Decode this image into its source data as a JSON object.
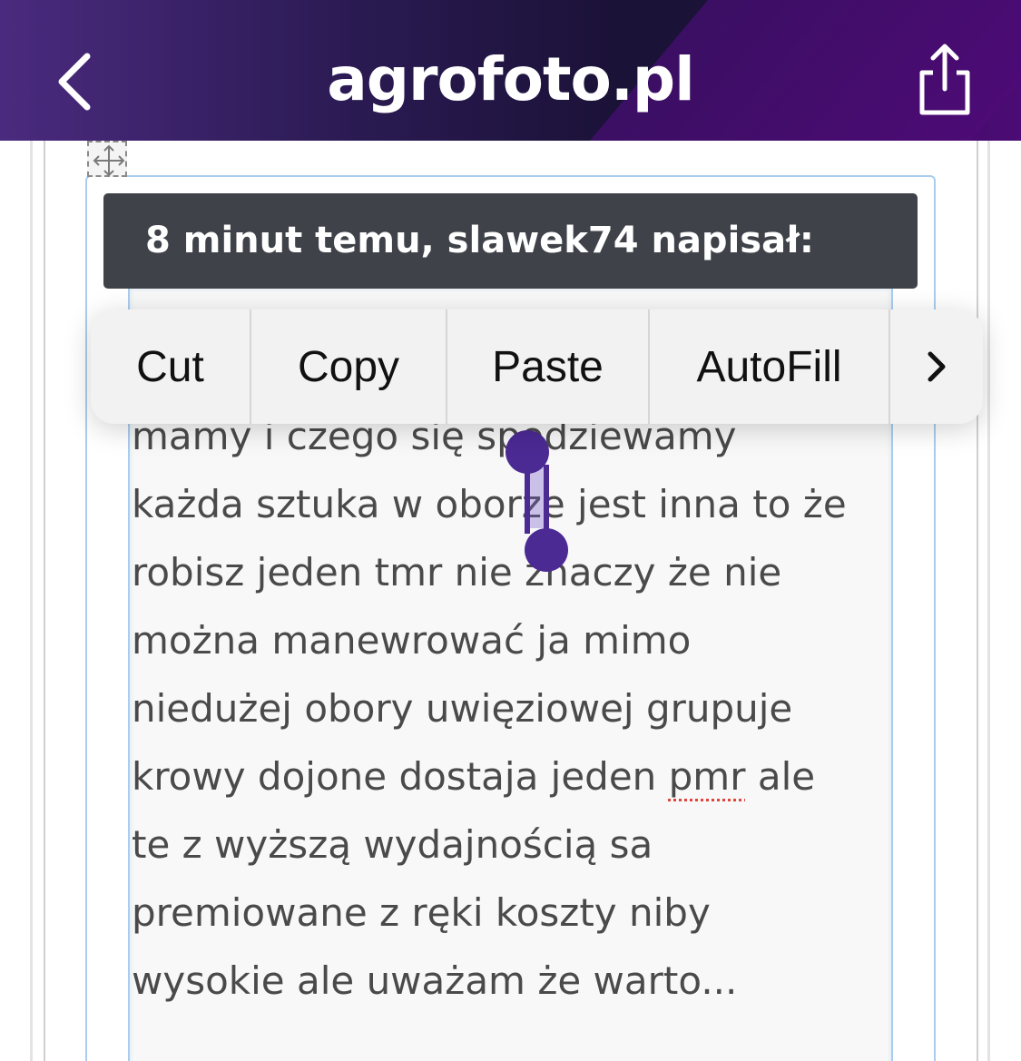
{
  "header": {
    "logo_text": "agrofoto.pl",
    "back_icon": "chevron-left-icon",
    "share_icon": "share-icon"
  },
  "quote": {
    "header_text": "8 minut temu, slawek74 napisał:",
    "lines": [
      "mamy i czego się spodziewamy",
      "każda sztuka w oborze jest inna to że",
      "robisz jeden tmr nie znaczy że nie",
      "można manewrować ja mimo",
      "niedużej obory uwięziowej grupuje",
      "krowy dojone dostaja jeden ",
      "pmr",
      " ale",
      "te z wyższą wydajnością sa",
      "premiowane z ręki koszty niby",
      "wysokie ale uważam że warto..."
    ]
  },
  "context_menu": {
    "cut": "Cut",
    "copy": "Copy",
    "paste": "Paste",
    "autofill": "AutoFill",
    "more": "›"
  },
  "colors": {
    "header_bg": "#2a1a52",
    "selection": "#4b2a93",
    "quote_header_bg": "#3f4248",
    "quote_border": "#a9cdee"
  }
}
